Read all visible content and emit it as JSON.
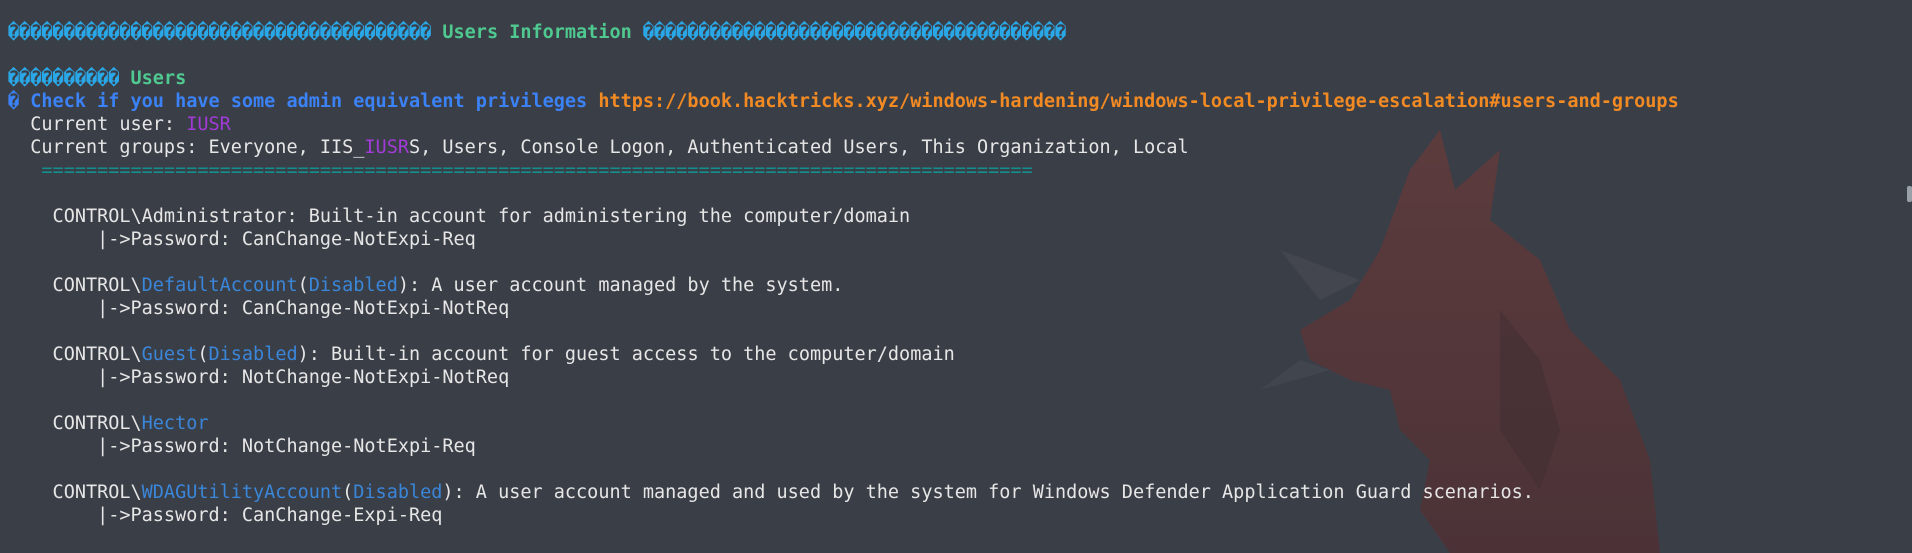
{
  "section": {
    "banner_left": "��������������������������������������",
    "title": " Users Information ",
    "banner_right": "��������������������������������������"
  },
  "subsection": {
    "banner": "����������",
    "title": " Users"
  },
  "check": {
    "glyph": "�",
    "text": " Check if you have some admin equivalent privileges ",
    "link": "https://book.hacktricks.xyz/windows-hardening/windows-local-privilege-escalation#users-and-groups"
  },
  "current_user": {
    "label": "  Current user: ",
    "value": "IUSR"
  },
  "current_groups": {
    "label": "  Current groups: Everyone, IIS_",
    "highlight": "IUSR",
    "rest": "S, Users, Console Logon, Authenticated Users, This Organization, Local"
  },
  "separator": "   =========================================================================================",
  "users": [
    {
      "prefix": "    CONTROL\\",
      "name": "Administrator",
      "disabled": "",
      "description": ": Built-in account for administering the computer/domain",
      "password": "        |->Password: CanChange-NotExpi-Req"
    },
    {
      "prefix": "    CONTROL\\",
      "name": "DefaultAccount",
      "disabled": "Disabled",
      "description": ": A user account managed by the system.",
      "password": "        |->Password: CanChange-NotExpi-NotReq"
    },
    {
      "prefix": "    CONTROL\\",
      "name": "Guest",
      "disabled": "Disabled",
      "description": ": Built-in account for guest access to the computer/domain",
      "password": "        |->Password: NotChange-NotExpi-NotReq"
    },
    {
      "prefix": "    CONTROL\\",
      "name": "Hector",
      "disabled": "",
      "description": "",
      "password": "        |->Password: NotChange-NotExpi-Req"
    },
    {
      "prefix": "    CONTROL\\",
      "name": "WDAGUtilityAccount",
      "disabled": "Disabled",
      "description": ": A user account managed and used by the system for Windows Defender Application Guard scenarios.",
      "password": "        |->Password: CanChange-Expi-Req"
    }
  ],
  "paren_open": "(",
  "paren_close": ")",
  "colors": {
    "background": "#3a3e47",
    "banner": "#2aa7e6",
    "title": "#4fc98f",
    "check": "#3b82f6",
    "link": "#f28a23",
    "user_highlight": "#a23bd6",
    "account_name": "#3a86d9",
    "separator": "#148f8f"
  },
  "icons": {
    "background_art": "fox-silhouette-wallpaper"
  }
}
